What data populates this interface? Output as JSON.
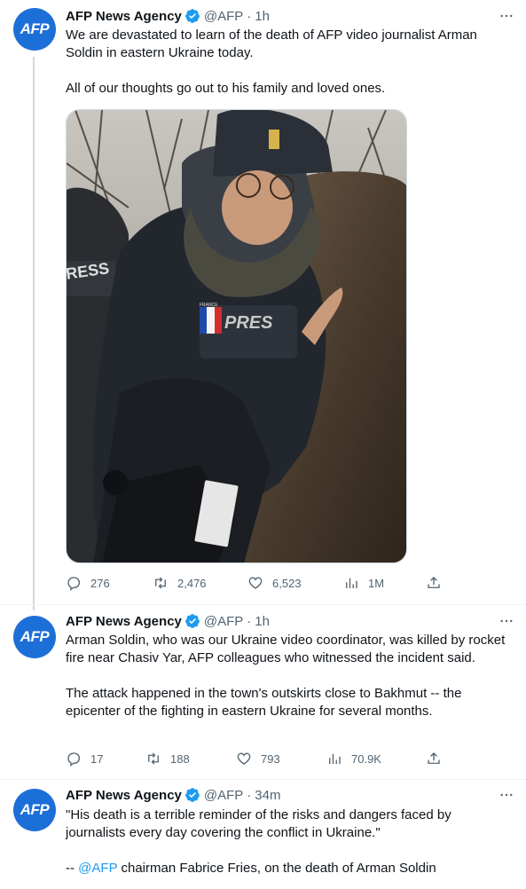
{
  "tweets": [
    {
      "author": {
        "name": "AFP News Agency",
        "handle": "@AFP",
        "avatar_text": "AFP"
      },
      "time": "1h",
      "paragraphs": [
        "We are devastated to learn of the death of AFP video journalist Arman Soldin in eastern Ukraine today.",
        "All of our thoughts go out to his family and loved ones."
      ],
      "media": {
        "vest_text_left": "RESS",
        "vest_text_main": "PRES",
        "flag_label": "FRANCE"
      },
      "stats": {
        "replies": "276",
        "retweets": "2,476",
        "likes": "6,523",
        "views": "1M"
      }
    },
    {
      "author": {
        "name": "AFP News Agency",
        "handle": "@AFP",
        "avatar_text": "AFP"
      },
      "time": "1h",
      "paragraphs": [
        "Arman Soldin, who was our Ukraine video coordinator, was killed by rocket fire near Chasiv Yar, AFP colleagues who witnessed the incident said.",
        "The attack happened in the town's outskirts close to Bakhmut -- the epicenter of the fighting in eastern Ukraine for several months."
      ],
      "stats": {
        "replies": "17",
        "retweets": "188",
        "likes": "793",
        "views": "70.9K"
      }
    },
    {
      "author": {
        "name": "AFP News Agency",
        "handle": "@AFP",
        "avatar_text": "AFP"
      },
      "time": "34m",
      "paragraphs": [
        "\"His death is a terrible reminder of the risks and dangers faced by journalists every day covering the conflict in Ukraine.\""
      ],
      "quote_prefix": "-- ",
      "mention": "@AFP",
      "quote_suffix": " chairman Fabrice Fries, on the death of Arman Soldin"
    }
  ],
  "separator": "·",
  "colors": {
    "accent": "#1d9bf0",
    "avatar": "#1d6fd8",
    "muted": "#536471"
  }
}
